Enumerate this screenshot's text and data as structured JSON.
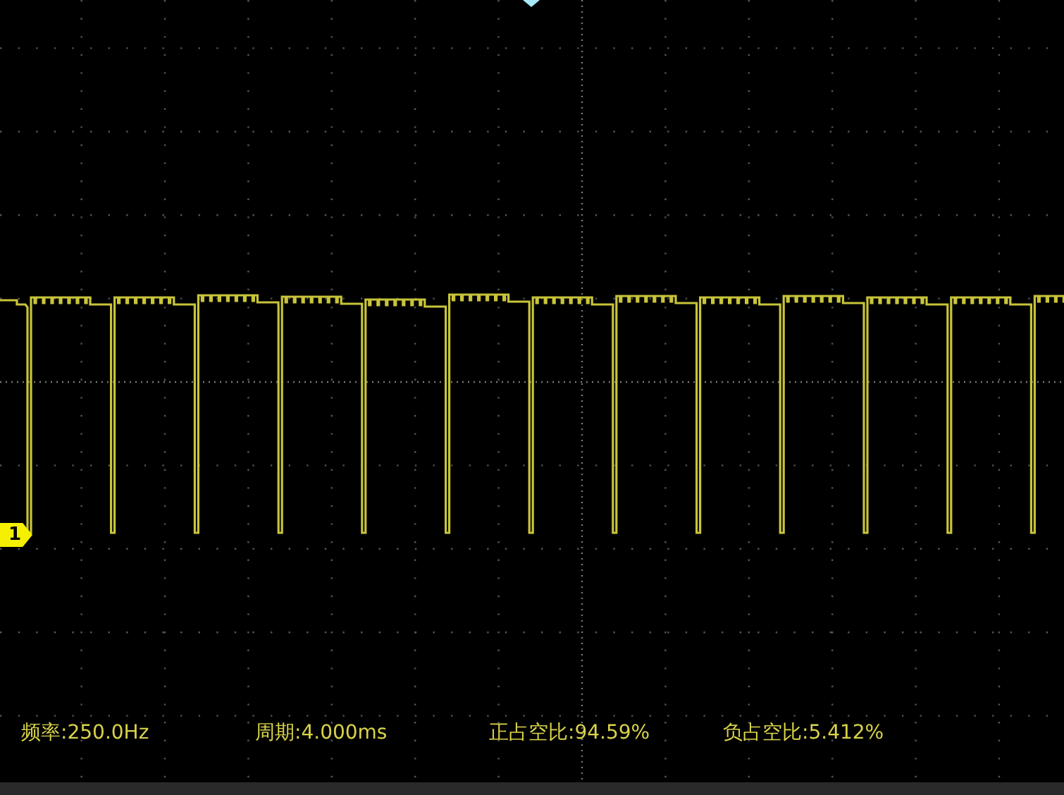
{
  "channel": {
    "label": "1"
  },
  "measurements": [
    {
      "text": "频率:250.0Hz"
    },
    {
      "text": "周期:4.000ms"
    },
    {
      "text": "正占空比:94.59%"
    },
    {
      "text": "负占空比:5.412%"
    }
  ]
}
